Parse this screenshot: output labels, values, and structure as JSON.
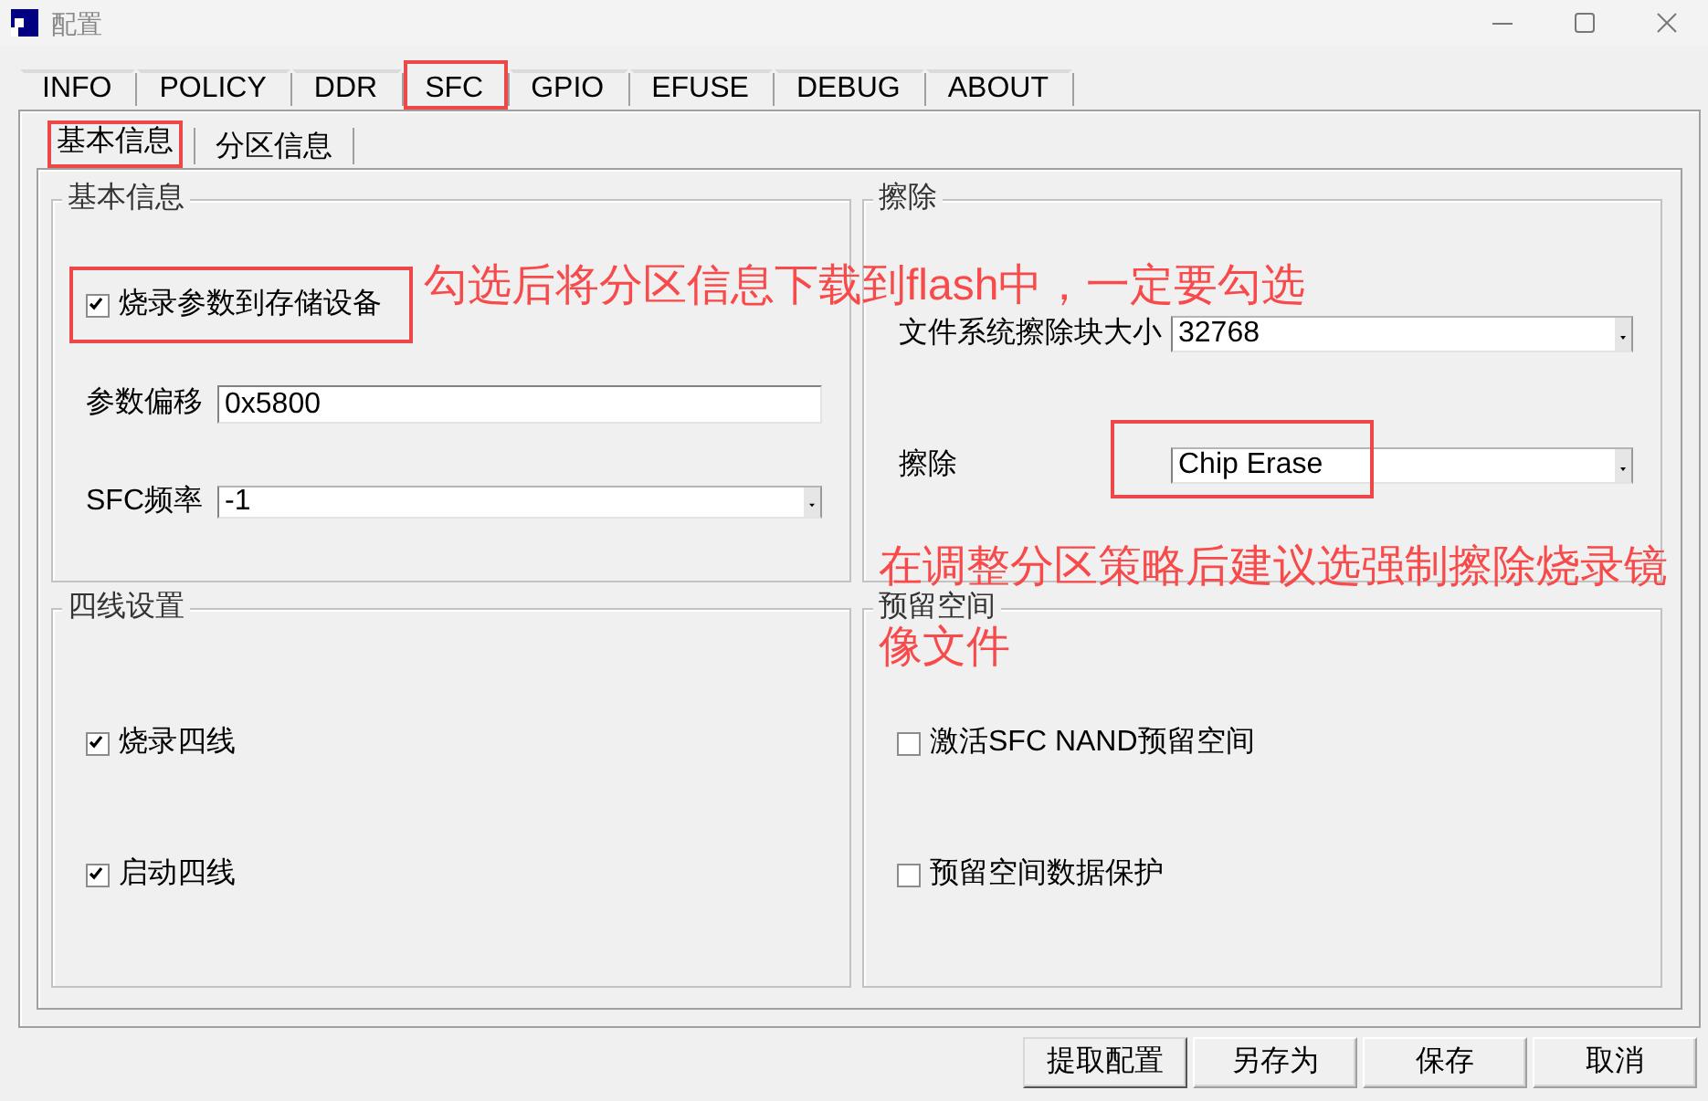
{
  "window": {
    "title": "配置"
  },
  "tabs": [
    {
      "label": "INFO",
      "selected": false,
      "highlighted": false
    },
    {
      "label": "POLICY",
      "selected": false,
      "highlighted": false
    },
    {
      "label": "DDR",
      "selected": false,
      "highlighted": false
    },
    {
      "label": "SFC",
      "selected": true,
      "highlighted": true
    },
    {
      "label": "GPIO",
      "selected": false,
      "highlighted": false
    },
    {
      "label": "EFUSE",
      "selected": false,
      "highlighted": false
    },
    {
      "label": "DEBUG",
      "selected": false,
      "highlighted": false
    },
    {
      "label": "ABOUT",
      "selected": false,
      "highlighted": false
    }
  ],
  "subtabs": [
    {
      "label": "基本信息",
      "selected": true,
      "highlighted": true
    },
    {
      "label": "分区信息",
      "selected": false,
      "highlighted": false
    }
  ],
  "groups": [
    {
      "title": "基本信息",
      "rows": [
        {
          "kind": "checkbox",
          "label": "烧录参数到存储设备",
          "checked": true,
          "highlighted": true
        },
        {
          "kind": "text",
          "label": "参数偏移",
          "value": "0x5800",
          "highlighted": false
        },
        {
          "kind": "combo",
          "label": "SFC频率",
          "value": "-1",
          "highlighted": false
        }
      ]
    },
    {
      "title": "擦除",
      "rows": [
        {
          "kind": "combo",
          "label": "文件系统擦除块大小",
          "value": "32768",
          "highlighted": false
        },
        {
          "kind": "combo",
          "label": "擦除",
          "value": "Chip Erase",
          "highlighted": true
        }
      ]
    },
    {
      "title": "四线设置",
      "rows": [
        {
          "kind": "checkbox",
          "label": "烧录四线",
          "checked": true,
          "highlighted": false
        },
        {
          "kind": "checkbox",
          "label": "启动四线",
          "checked": true,
          "highlighted": false
        }
      ]
    },
    {
      "title": "预留空间",
      "rows": [
        {
          "kind": "checkbox",
          "label": "激活SFC NAND预留空间",
          "checked": false,
          "highlighted": false
        },
        {
          "kind": "checkbox",
          "label": "预留空间数据保护",
          "checked": false,
          "highlighted": false
        }
      ]
    }
  ],
  "annotations": [
    {
      "lines": [
        "勾选后将分区信息下载到flash中，一定要勾选"
      ]
    },
    {
      "lines": [
        "在调整分区策略后建议选强制擦除烧录镜",
        "像文件"
      ]
    }
  ],
  "buttons": [
    {
      "label": "提取配置",
      "default": true
    },
    {
      "label": "另存为",
      "default": false
    },
    {
      "label": "保存",
      "default": false
    },
    {
      "label": "取消",
      "default": false
    }
  ]
}
